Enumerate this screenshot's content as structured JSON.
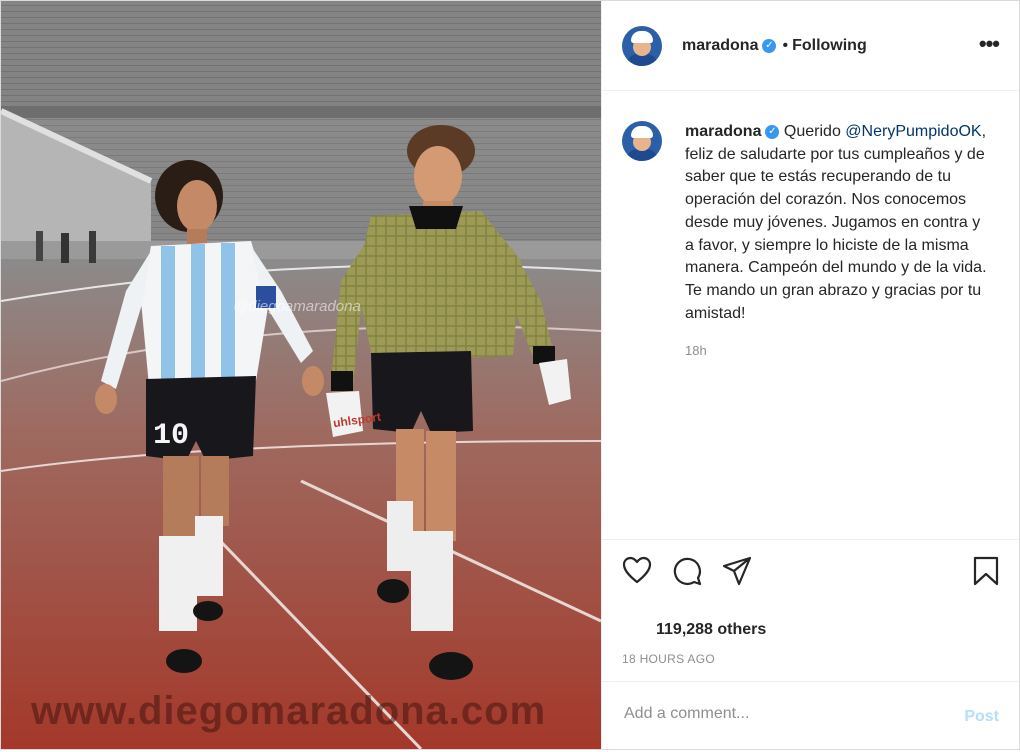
{
  "post": {
    "author": "maradona",
    "follow_label": "Following",
    "dot_separator": "•",
    "more_label": "•••",
    "caption_user": "maradona",
    "caption_lead": "Querido",
    "caption_mention": "@NeryPumpidoOK",
    "caption_body": ", feliz de saludarte por tus cumpleaños y de saber que te estás recuperando de tu operación del corazón. Nos conocemos desde muy jóvenes. Jugamos en contra y a favor, y siempre lo hiciste de la misma manera. Campeón del mundo y de la vida. Te mando un gran abrazo y gracias por tu amistad!",
    "caption_time": "18h",
    "likes_text": "119,288 others",
    "timestamp": "18 HOURS AGO",
    "comment_placeholder": "Add a comment...",
    "post_button": "Post"
  },
  "photo": {
    "watermark_handle": "@diegoamaradona",
    "site_watermark": "www.diegomaradona.com",
    "shirt_number": "10",
    "glove_brand": "uhlsport"
  },
  "colors": {
    "verified": "#3897f0",
    "mention": "#00376b",
    "post_button": "#b2dffc",
    "track": "#a83a2c"
  },
  "icons": [
    "verified-badge-icon",
    "more-options-icon",
    "heart-icon",
    "comment-icon",
    "share-icon",
    "bookmark-icon"
  ]
}
